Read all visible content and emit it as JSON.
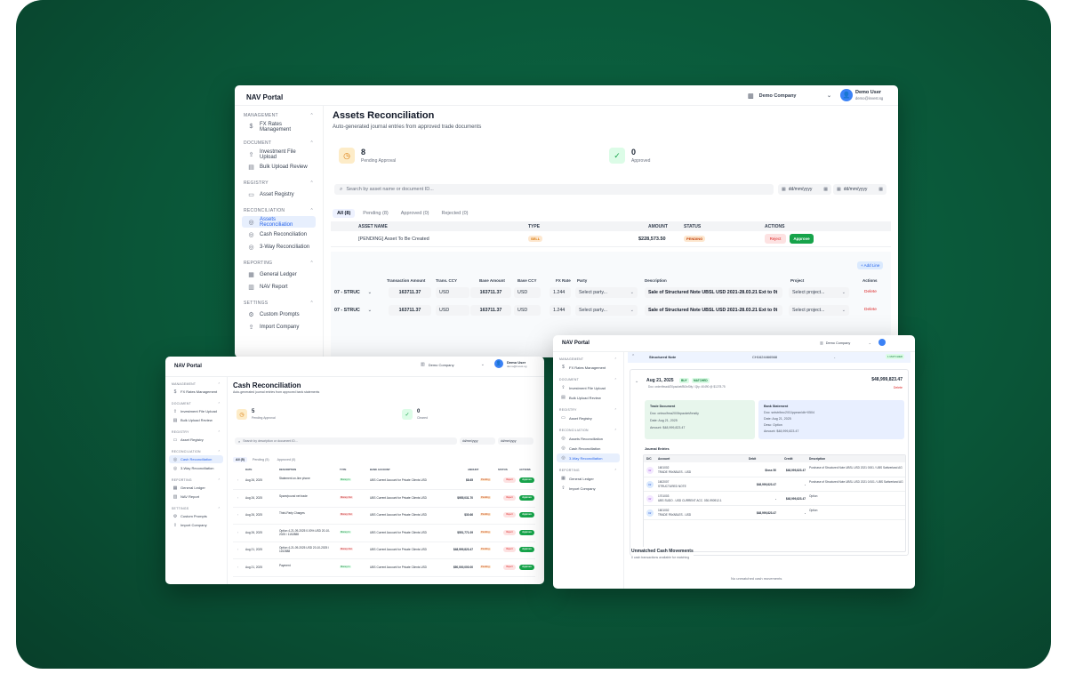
{
  "assets_window": {
    "brand": "NAV Portal",
    "company": "Demo Company",
    "user_name": "Demo User",
    "user_email": "demo@invest.sg",
    "sidebar": [
      {
        "section": "MANAGEMENT",
        "items": [
          {
            "icon": "dollar-icon",
            "label": "FX Rates Management"
          }
        ]
      },
      {
        "section": "DOCUMENT",
        "items": [
          {
            "icon": "upload-icon",
            "label": "Investment File Upload"
          },
          {
            "icon": "file-icon",
            "label": "Bulk Upload Review"
          }
        ]
      },
      {
        "section": "REGISTRY",
        "items": [
          {
            "icon": "list-icon",
            "label": "Asset Registry"
          }
        ]
      },
      {
        "section": "RECONCILIATION",
        "items": [
          {
            "icon": "check-circle-icon",
            "label": "Assets Reconciliation",
            "active": true
          },
          {
            "icon": "check-circle-icon",
            "label": "Cash Reconciliation"
          },
          {
            "icon": "check-circle-icon",
            "label": "3-Way Reconciliation"
          }
        ]
      },
      {
        "section": "REPORTING",
        "items": [
          {
            "icon": "ledger-icon",
            "label": "General Ledger"
          },
          {
            "icon": "chart-icon",
            "label": "NAV Report"
          }
        ]
      },
      {
        "section": "SETTINGS",
        "items": [
          {
            "icon": "gear-icon",
            "label": "Custom Prompts"
          },
          {
            "icon": "upload-icon",
            "label": "Import Company"
          }
        ]
      }
    ],
    "title": "Assets Reconciliation",
    "subtitle": "Auto-generated journal entries from approved trade documents",
    "stats": [
      {
        "value": "8",
        "label": "Pending Approval"
      },
      {
        "value": "0",
        "label": "Approved"
      }
    ],
    "search_placeholder": "Search by asset name or document ID...",
    "date_placeholder": "dd/mm/yyyy",
    "tabs": [
      "All (8)",
      "Pending (8)",
      "Approved (0)",
      "Rejected (0)"
    ],
    "table_headers": [
      "ASSET NAME",
      "TYPE",
      "AMOUNT",
      "STATUS",
      "ACTIONS"
    ],
    "row": {
      "name": "[PENDING] Asset To Be Created",
      "type": "SELL",
      "amount": "$228,573.50",
      "status": "PENDING",
      "reject": "Reject",
      "approve": "Approve"
    },
    "add_line": "+ Add Line",
    "line_headers": [
      "Transaction Amount",
      "Trans. CCY",
      "Base Amount",
      "Base CCY",
      "FX Rate",
      "Party",
      "Description",
      "Project",
      "Actions"
    ],
    "lines": [
      {
        "account": "07 - STRUC",
        "trans_amount": "163711.37",
        "trans_ccy": "USD",
        "base_amount": "163711.37",
        "base_ccy": "USD",
        "fx": "1.244",
        "party": "Select party...",
        "description": "Sale of Structured Note UBSL USD 2021-28.03.21 Ext to 0t",
        "project": "Select project...",
        "action": "Delete"
      },
      {
        "account": "07 - STRUC",
        "trans_amount": "163711.37",
        "trans_ccy": "USD",
        "base_amount": "163711.37",
        "base_ccy": "USD",
        "fx": "1.244",
        "party": "Select party...",
        "description": "Sale of Structured Note UBSL USD 2021-28.03.21 Ext to 0t",
        "project": "Select project...",
        "action": "Delete"
      }
    ]
  },
  "cash_window": {
    "brand": "NAV Portal",
    "company": "Demo Company",
    "user_name": "Demo User",
    "user_email": "demo@invest.sg",
    "sidebar": [
      {
        "section": "MANAGEMENT",
        "items": [
          {
            "icon": "dollar-icon",
            "label": "FX Rates Management"
          }
        ]
      },
      {
        "section": "DOCUMENT",
        "items": [
          {
            "icon": "upload-icon",
            "label": "Investment File Upload"
          },
          {
            "icon": "file-icon",
            "label": "Bulk Upload Review"
          }
        ]
      },
      {
        "section": "REGISTRY",
        "items": [
          {
            "icon": "list-icon",
            "label": "Asset Registry"
          }
        ]
      },
      {
        "section": "RECONCILIATION",
        "items": [
          {
            "icon": "check-circle-icon",
            "label": "Cash Reconciliation",
            "active": true
          },
          {
            "icon": "check-circle-icon",
            "label": "3-Way Reconciliation"
          }
        ]
      },
      {
        "section": "REPORTING",
        "items": [
          {
            "icon": "ledger-icon",
            "label": "General Ledger"
          },
          {
            "icon": "chart-icon",
            "label": "NAV Report"
          }
        ]
      },
      {
        "section": "SETTINGS",
        "items": [
          {
            "icon": "gear-icon",
            "label": "Custom Prompts"
          },
          {
            "icon": "upload-icon",
            "label": "Import Company"
          }
        ]
      }
    ],
    "title": "Cash Reconciliation",
    "subtitle": "Auto-generated journal entries from approved bank statements",
    "stats": [
      {
        "value": "5",
        "label": "Pending Approval"
      },
      {
        "value": "0",
        "label": "Cleared"
      }
    ],
    "search_placeholder": "Search by description or document ID...",
    "date_placeholder": "dd/mm/yyyy",
    "tabs": [
      "All (5)",
      "Pending (5)",
      "Approved (0)"
    ],
    "headers": [
      "DATE",
      "DESCRIPTION",
      "TYPE",
      "BANK ACCOUNT",
      "AMOUNT",
      "STATUS",
      "ACTIONS"
    ],
    "rows": [
      {
        "date": "Aug 26, 2025",
        "desc": "Statement on-line phone",
        "type": "Money In",
        "bank": "UBS Current Account for Private Clients USD",
        "amount": "$8.65",
        "status": "Pending"
      },
      {
        "date": "Aug 26, 2025",
        "desc": "Spare/pound net trade",
        "type": "Money Out",
        "bank": "UBS Current Account for Private Clients USD",
        "amount": "$955,031.70",
        "status": "Pending"
      },
      {
        "date": "Aug 26, 2025",
        "desc": "Third-Party Charges",
        "type": "Money Out",
        "bank": "UBS Current Account for Private Clients USD",
        "amount": "$30.66",
        "status": "Pending"
      },
      {
        "date": "Aug 26, 2025",
        "desc": "Option 4-21-09-2025 0.00% USD 20-10-2025 / 1152888",
        "type": "Money In",
        "bank": "UBS Current Account for Private Clients USD",
        "amount": "$551,771.09",
        "status": "Pending"
      },
      {
        "date": "Aug 21, 2025",
        "desc": "Option 4-21-09-2025 USD 20-10-2025 / 1152888",
        "type": "Money Out",
        "bank": "UBS Current Account for Private Clients USD",
        "amount": "$48,999,823.47",
        "status": "Pending"
      },
      {
        "date": "Aug 21, 2025",
        "desc": "Payment",
        "type": "Money In",
        "bank": "UBS Current Account for Private Clients USD",
        "amount": "$50,000,000.00",
        "status": "Pending"
      }
    ],
    "reject": "Reject",
    "approve": "Approve"
  },
  "threeway_window": {
    "brand": "NAV Portal",
    "company": "Demo Company",
    "sidebar": [
      {
        "section": "MANAGEMENT",
        "items": [
          {
            "icon": "dollar-icon",
            "label": "FX Rates Management"
          }
        ]
      },
      {
        "section": "DOCUMENT",
        "items": [
          {
            "icon": "upload-icon",
            "label": "Investment File Upload"
          },
          {
            "icon": "file-icon",
            "label": "Bulk Upload Review"
          }
        ]
      },
      {
        "section": "REGISTRY",
        "items": [
          {
            "icon": "list-icon",
            "label": "Asset Registry"
          }
        ]
      },
      {
        "section": "RECONCILIATION",
        "items": [
          {
            "icon": "check-circle-icon",
            "label": "Assets Reconciliation"
          },
          {
            "icon": "check-circle-icon",
            "label": "Cash Reconciliation"
          },
          {
            "icon": "check-circle-icon",
            "label": "3-Way Reconciliation",
            "active": true
          }
        ]
      },
      {
        "section": "REPORTING",
        "items": [
          {
            "icon": "ledger-icon",
            "label": "General Ledger"
          },
          {
            "icon": "upload-icon",
            "label": "Import Company"
          }
        ]
      }
    ],
    "header_row": {
      "name": "Structured Note",
      "code": "CH1624466568",
      "dash": "-",
      "matched": "1 MATCHED"
    },
    "entry": {
      "date": "Aug 21, 2025",
      "type": "BUY",
      "status": "MATCHED",
      "amount": "$48,999,823.47",
      "doc": "Doc: order/fmadi/20packet/Bt3nStly / Qty: 40490 @ $1278.75",
      "delete": "Delete"
    },
    "trade_doc": {
      "title": "Trade Document",
      "doc": "Doc: ontwo/fma20/0bpacket/bnstly",
      "date": "Date: Aug 21, 2025",
      "amount": "Amount: $48,999,823.47"
    },
    "bank_doc": {
      "title": "Bank Statement",
      "doc": "Doc: sntstr/bnc2/01/ppean/db+0504",
      "date": "Date: Aug 21, 2025",
      "desc": "Desc: Option",
      "amount": "Amount: $48,999,823.47"
    },
    "journal_title": "Journal Entries",
    "journal_headers": [
      "D/C",
      "Account",
      "Debit",
      "Credit",
      "Description"
    ],
    "journal_rows": [
      {
        "dc": "Cr",
        "code": "1601002",
        "account": "TRADE PAYABLES - USD",
        "debit": "$loss 50",
        "credit": "$48,999,823.47",
        "desc": "Purchase of Structured Note UBSL USD 2021 0001 / UBS Switzerland AG"
      },
      {
        "dc": "Dr",
        "code": "1602007",
        "account": "STRUCTURED NOTE",
        "debit": "$48,999,823.47",
        "credit": "-",
        "desc": "Purchase of Structured Note UBSL USD 2021 0/101 / UBS Switzerland AG"
      },
      {
        "dc": "Cr",
        "code": "1701003",
        "account": "UBS SUDO - USD CURRENT ACC. 030-990912-1",
        "debit": "-",
        "credit": "$48,999,823.47",
        "desc": "Option"
      },
      {
        "dc": "Dr",
        "code": "1601002",
        "account": "TRADE PAYABLES - USD",
        "debit": "$48,999,823.47",
        "credit": "-",
        "desc": "Option"
      }
    ],
    "unmatched_title": "Unmatched Cash Movements",
    "unmatched_sub": "0 cash transactions available for matching",
    "unmatched_empty": "No unmatched cash movements"
  },
  "colors": {
    "background": "#0a5638",
    "accent": "#2563eb",
    "success": "#16a34a",
    "warning": "#d97706",
    "danger": "#dc2626"
  }
}
